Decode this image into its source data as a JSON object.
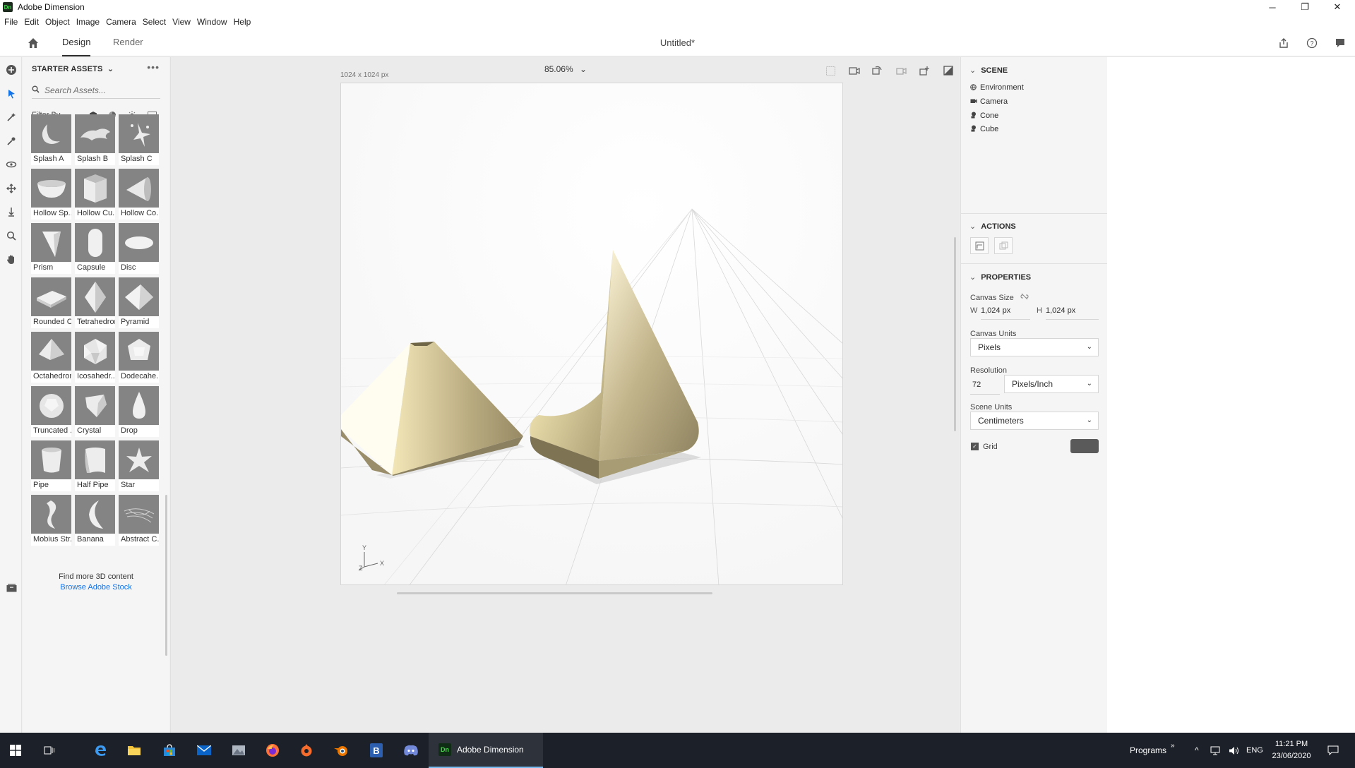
{
  "window": {
    "app_badge": "Dn",
    "title": "Adobe Dimension",
    "minimize": "─",
    "maximize": "❐",
    "close": "✕"
  },
  "menu": [
    "File",
    "Edit",
    "Object",
    "Image",
    "Camera",
    "Select",
    "View",
    "Window",
    "Help"
  ],
  "tabs": {
    "design": "Design",
    "render": "Render",
    "document_title": "Untitled*"
  },
  "assets": {
    "header": "STARTER ASSETS",
    "search_placeholder": "Search Assets...",
    "filter_label": "Filter By",
    "items": [
      {
        "label": "Splash A"
      },
      {
        "label": "Splash B"
      },
      {
        "label": "Splash C"
      },
      {
        "label": "Hollow Sp..."
      },
      {
        "label": "Hollow Cu..."
      },
      {
        "label": "Hollow Co..."
      },
      {
        "label": "Prism"
      },
      {
        "label": "Capsule"
      },
      {
        "label": "Disc"
      },
      {
        "label": "Rounded C..."
      },
      {
        "label": "Tetrahedron"
      },
      {
        "label": "Pyramid"
      },
      {
        "label": "Octahedron"
      },
      {
        "label": "Icosahedr..."
      },
      {
        "label": "Dodecahe..."
      },
      {
        "label": "Truncated ..."
      },
      {
        "label": "Crystal"
      },
      {
        "label": "Drop"
      },
      {
        "label": "Pipe"
      },
      {
        "label": "Half Pipe"
      },
      {
        "label": "Star"
      },
      {
        "label": "Mobius Str..."
      },
      {
        "label": "Banana"
      },
      {
        "label": "Abstract C..."
      }
    ],
    "find_more": "Find more 3D content",
    "browse_link": "Browse Adobe Stock"
  },
  "canvas": {
    "zoom": "85.06%",
    "size_label": "1024 x 1024 px",
    "axis_y": "Y",
    "axis_x": "X",
    "axis_z": "Z"
  },
  "scene": {
    "title": "SCENE",
    "items": [
      "Environment",
      "Camera",
      "Cone",
      "Cube"
    ]
  },
  "actions": {
    "title": "ACTIONS"
  },
  "properties": {
    "title": "PROPERTIES",
    "canvas_size_label": "Canvas Size",
    "w_label": "W",
    "w_value": "1,024 px",
    "h_label": "H",
    "h_value": "1,024 px",
    "canvas_units_label": "Canvas Units",
    "canvas_units_value": "Pixels",
    "resolution_label": "Resolution",
    "resolution_value": "72",
    "resolution_units": "Pixels/Inch",
    "scene_units_label": "Scene Units",
    "scene_units_value": "Centimeters",
    "grid_label": "Grid",
    "grid_checked": true,
    "grid_color": "#5a5a5a"
  },
  "taskbar": {
    "active_app": "Adobe Dimension",
    "active_badge": "Dn",
    "programs": "Programs",
    "language": "ENG",
    "time": "11:21 PM",
    "date": "23/06/2020"
  },
  "colors": {
    "accent": "#1473e6",
    "taskbar": "#1c2028",
    "gold_object": "#c9bf95"
  }
}
